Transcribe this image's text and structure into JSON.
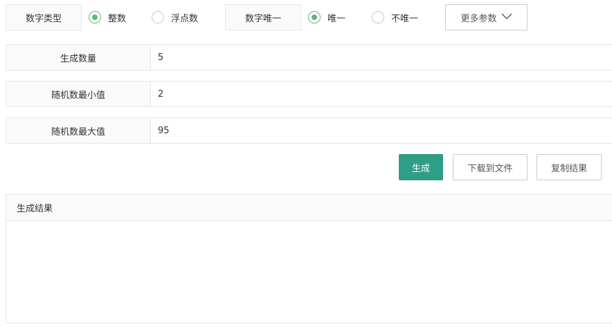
{
  "type_group": {
    "label": "数字类型",
    "options": [
      {
        "label": "整数",
        "checked": true
      },
      {
        "label": "浮点数",
        "checked": false
      }
    ]
  },
  "unique_group": {
    "label": "数字唯一",
    "options": [
      {
        "label": "唯一",
        "checked": true
      },
      {
        "label": "不唯一",
        "checked": false
      }
    ]
  },
  "more_params": {
    "label": "更多参数"
  },
  "fields": {
    "count": {
      "label": "生成数量",
      "value": "5"
    },
    "min": {
      "label": "随机数最小值",
      "value": "2"
    },
    "max": {
      "label": "随机数最大值",
      "value": "95"
    }
  },
  "actions": {
    "generate": "生成",
    "download": "下载到文件",
    "copy": "复制结果"
  },
  "result": {
    "title": "生成结果",
    "content": ""
  },
  "colors": {
    "accent": "#2e9e86",
    "radio_checked": "#5fb878",
    "border": "#e6e6e6",
    "label_bg": "#fafafa"
  }
}
